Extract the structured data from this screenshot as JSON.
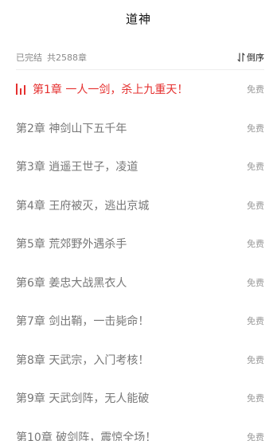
{
  "header": {
    "title": "道神"
  },
  "book_meta": {
    "status": "已完结",
    "chapter_count": "共2588章",
    "sort_label": "倒序"
  },
  "chapters": [
    {
      "title": "第1章 一人一剑，杀上九重天！",
      "tag": "免费"
    },
    {
      "title": "第2章 神剑山下五千年",
      "tag": "免费"
    },
    {
      "title": "第3章 逍遥王世子，凌道",
      "tag": "免费"
    },
    {
      "title": "第4章 王府被灭，逃出京城",
      "tag": "免费"
    },
    {
      "title": "第5章 荒郊野外遇杀手",
      "tag": "免费"
    },
    {
      "title": "第6章 姜忠大战黑衣人",
      "tag": "免费"
    },
    {
      "title": "第7章 剑出鞘，一击毙命！",
      "tag": "免费"
    },
    {
      "title": "第8章 天武宗，入门考核！",
      "tag": "免费"
    },
    {
      "title": "第9章 天武剑阵，无人能破",
      "tag": "免费"
    },
    {
      "title": "第10章 破剑阵，震惊全场！",
      "tag": "免费"
    }
  ],
  "colors": {
    "active_chapter": "#e5302f",
    "chapter_text": "#777777",
    "tag_text": "#9a9a9a"
  },
  "icons": {
    "playing": "playing-indicator-icon",
    "sort": "sort-toggle-icon"
  }
}
